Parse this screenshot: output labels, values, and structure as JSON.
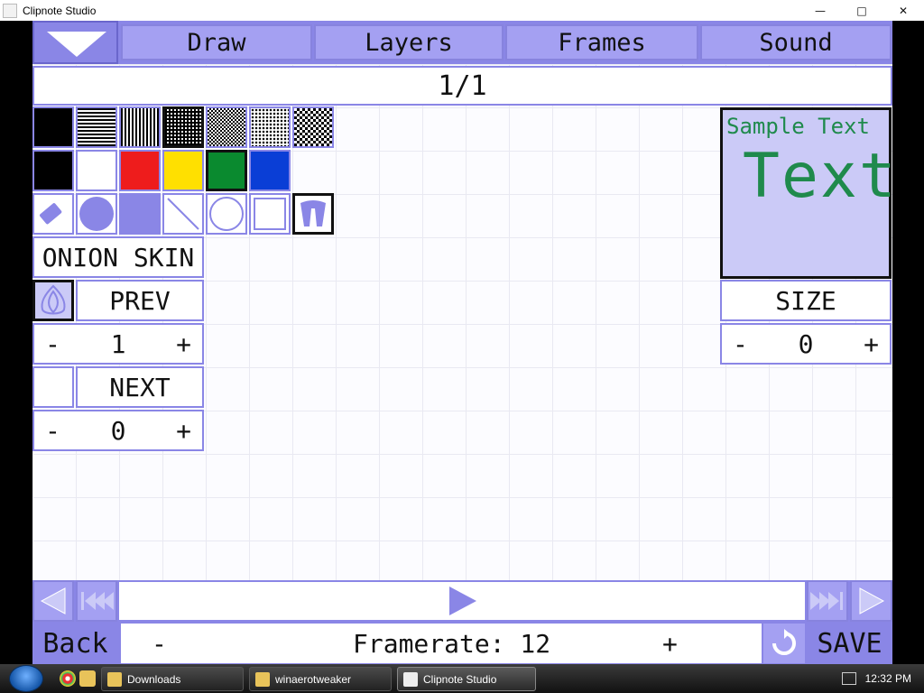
{
  "window": {
    "title": "Clipnote Studio"
  },
  "tabs": [
    {
      "label": "Draw"
    },
    {
      "label": "Layers"
    },
    {
      "label": "Frames"
    },
    {
      "label": "Sound"
    }
  ],
  "page_indicator": "1/1",
  "colors": [
    "#000000",
    "#ffffff",
    "#ee1c1c",
    "#ffe000",
    "#0a8a2f",
    "#0a3ed6"
  ],
  "onion_skin": {
    "title": "ONION SKIN",
    "prev_label": "PREV",
    "prev_value": "1",
    "next_label": "NEXT",
    "next_value": "0",
    "minus": "-",
    "plus": "+"
  },
  "text_tool": {
    "sample_small": "Sample Text",
    "sample_big": "Text",
    "size_label": "SIZE",
    "size_value": "0",
    "minus": "-",
    "plus": "+"
  },
  "bottom": {
    "back_label": "Back",
    "framerate_minus": "-",
    "framerate_label": "Framerate: 12",
    "framerate_plus": "+",
    "save_label": "SAVE"
  },
  "taskbar": {
    "tasks": [
      {
        "label": "Downloads"
      },
      {
        "label": "winaerotweaker"
      },
      {
        "label": "Clipnote Studio"
      }
    ],
    "clock": "12:32 PM"
  },
  "accent_color": "#8a86e6"
}
